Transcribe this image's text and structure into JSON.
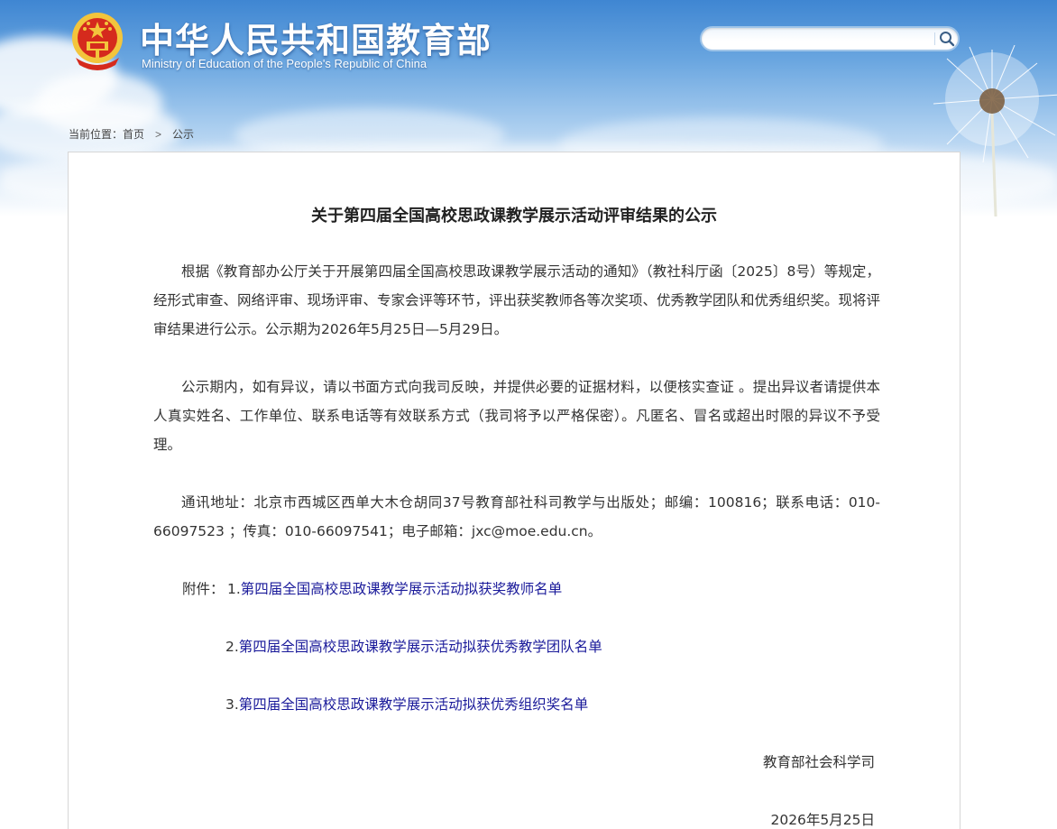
{
  "header": {
    "title_cn": "中华人民共和国教育部",
    "title_en": "Ministry of Education of the People's Republic of China",
    "emblem_icon": "national-emblem-icon"
  },
  "search": {
    "placeholder": "",
    "value": "",
    "button_icon": "search-icon"
  },
  "breadcrumb": {
    "prefix": "当前位置：",
    "home": "首页",
    "separator": ">",
    "current": "公示"
  },
  "article": {
    "title": "关于第四届全国高校思政课教学展示活动评审结果的公示",
    "paragraphs": [
      "根据《教育部办公厅关于开展第四届全国高校思政课教学展示活动的通知》（教社科厅函〔2025〕8号）等规定，经形式审查、网络评审、现场评审、专家会评等环节，评出获奖教师各等次奖项、优秀教学团队和优秀组织奖。现将评审结果进行公示。公示期为2026年5月25日—5月29日。",
      "公示期内，如有异议，请以书面方式向我司反映，并提供必要的证据材料，以便核实查证 。提出异议者请提供本人真实姓名、工作单位、联系电话等有效联系方式（我司将予以严格保密）。凡匿名、冒名或超出时限的异议不予受理。",
      "通讯地址：北京市西城区西单大木仓胡同37号教育部社科司教学与出版处；邮编：100816；联系电话：010-66097523 ；传真：010-66097541；电子邮箱：jxc@moe.edu.cn。"
    ],
    "attachments_label": "附件：",
    "attachments": [
      {
        "num": "1.",
        "text": "第四届全国高校思政课教学展示活动拟获奖教师名单"
      },
      {
        "num": "2.",
        "text": "第四届全国高校思政课教学展示活动拟获优秀教学团队名单"
      },
      {
        "num": "3.",
        "text": "第四届全国高校思政课教学展示活动拟获优秀组织奖名单"
      }
    ],
    "signoff": "教育部社会科学司",
    "date": "2026年5月25日"
  },
  "colors": {
    "link": "#1a1a9a",
    "emblem_red": "#d52a1d",
    "emblem_gold": "#f3c53c"
  }
}
